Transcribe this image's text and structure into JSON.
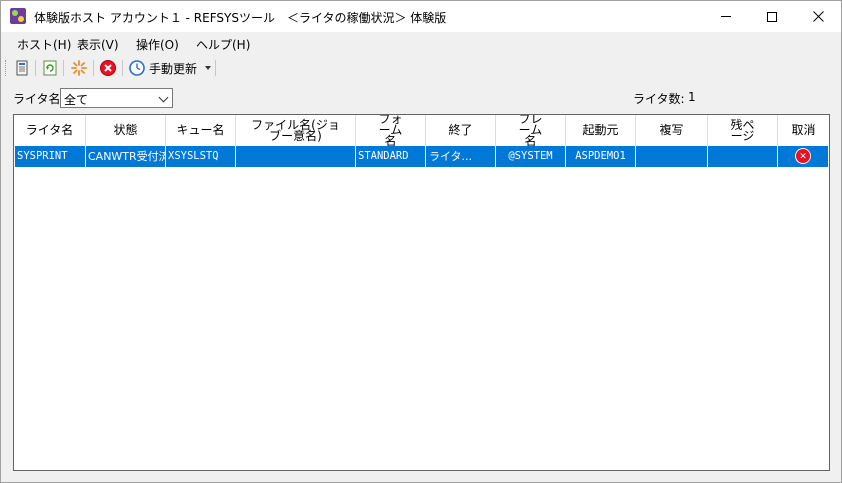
{
  "window": {
    "title": "体験版ホスト アカウント１ - REFSYSツール　＜ライタの稼働状況＞ 体験版"
  },
  "menu": {
    "items": [
      {
        "label": "ホスト(H)"
      },
      {
        "label": "表示(V)"
      },
      {
        "label": "操作(O)"
      },
      {
        "label": "ヘルプ(H)"
      }
    ]
  },
  "toolbar": {
    "icons": [
      "document-icon",
      "refresh-icon",
      "settings-burst-icon",
      "stop-icon",
      "clock-icon"
    ],
    "refresh_mode_label": "手動更新"
  },
  "filter": {
    "label": "ライタ名",
    "selected": "全て"
  },
  "count": {
    "label": "ライタ数:",
    "value": "1"
  },
  "table": {
    "columns": [
      {
        "label": "ライタ名"
      },
      {
        "label": "状態"
      },
      {
        "label": "キュー名"
      },
      {
        "label": "ファイル名(ジョブー意名)"
      },
      {
        "label": "フォーム名"
      },
      {
        "label": "終了"
      },
      {
        "label": "フレーム名"
      },
      {
        "label": "起動元"
      },
      {
        "label": "複写"
      },
      {
        "label": "残ページ"
      },
      {
        "label": "取消"
      }
    ],
    "rows": [
      {
        "writer": "SYSPRINT",
        "status": "CANWTR受付済",
        "queue": "XSYSLSTQ",
        "file": "",
        "form": "STANDARD",
        "end": "ライタ...",
        "frame": "@SYSTEM",
        "origin": "ASPDEMO1",
        "copies": "",
        "remaining": "",
        "cancel_icon": "cancel-icon"
      }
    ]
  },
  "colors": {
    "selection": "#0078d7",
    "cancel": "#e81123"
  }
}
